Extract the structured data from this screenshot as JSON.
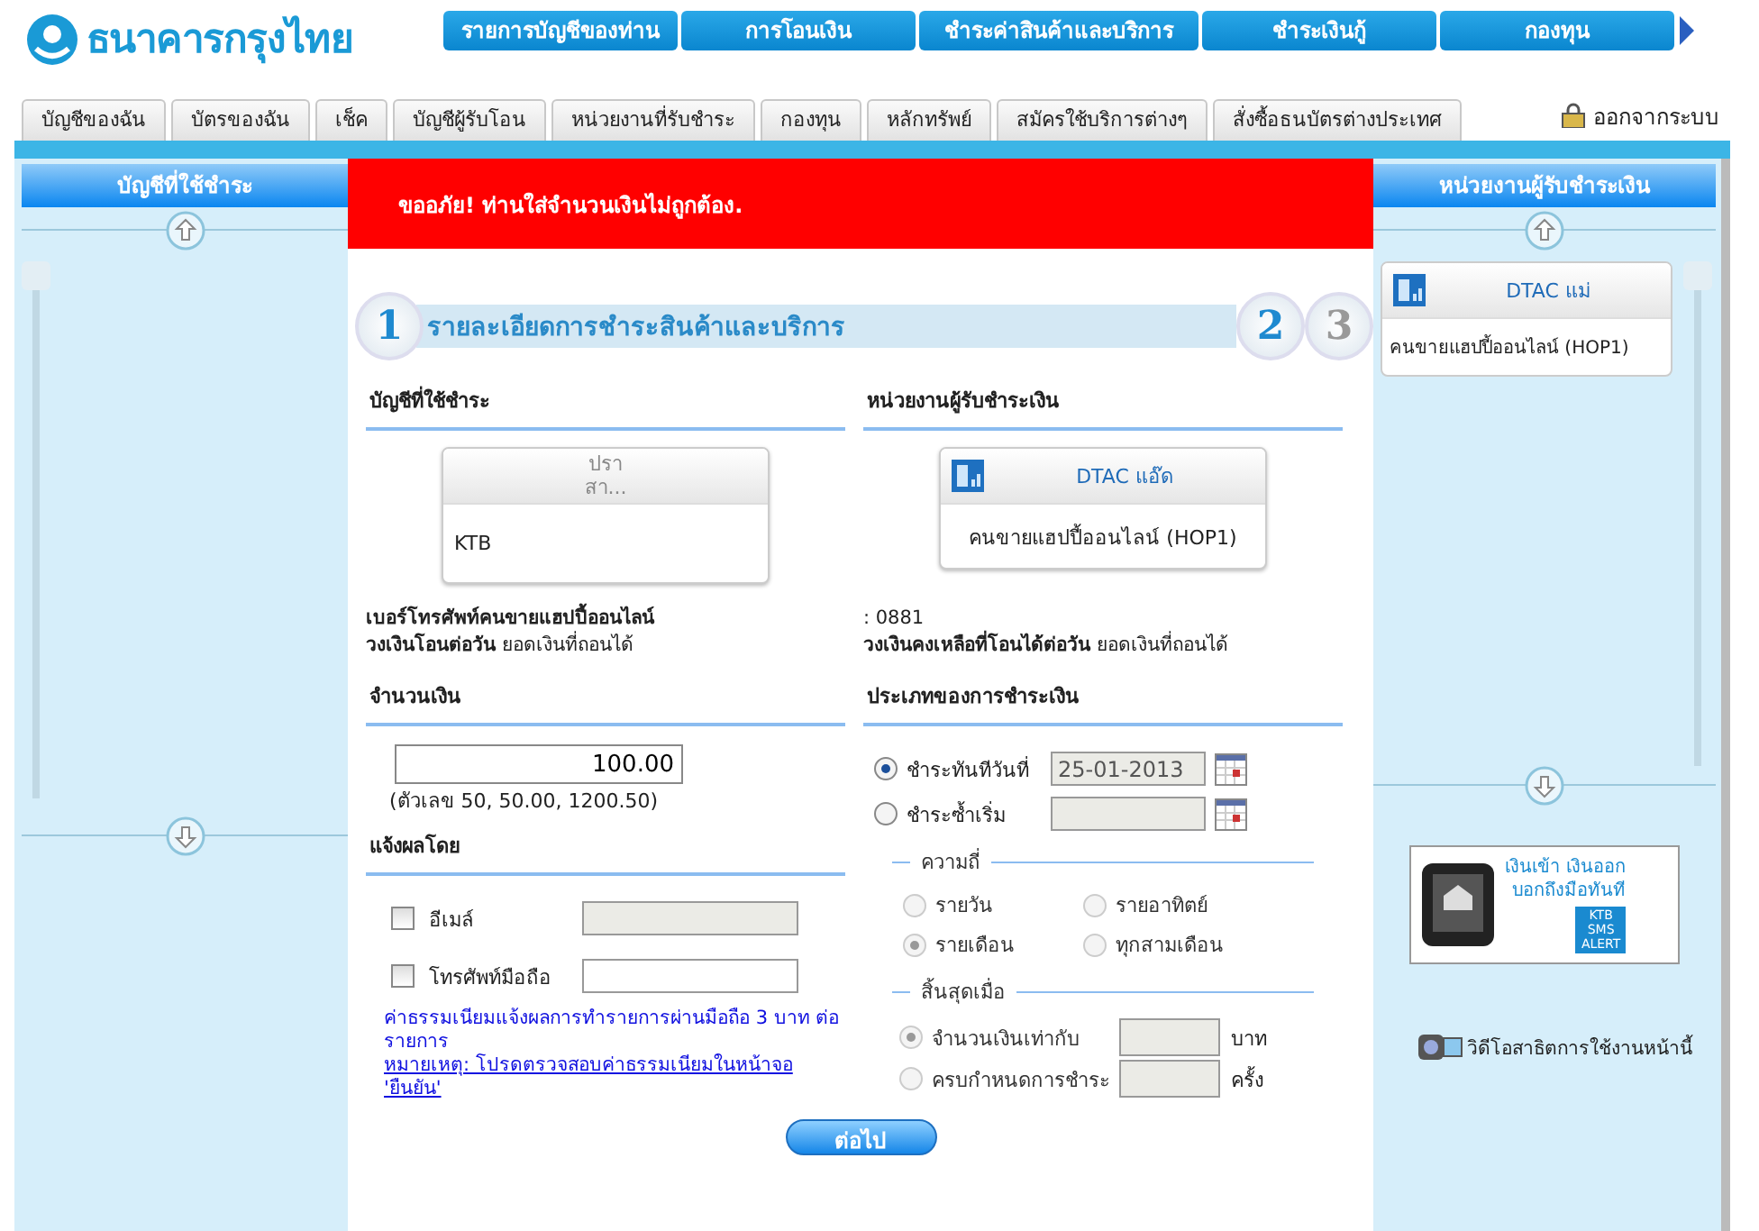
{
  "logo": {
    "text": "ธนาคารกรุงไทย"
  },
  "top_nav": [
    {
      "label": "รายการบัญชีของท่าน"
    },
    {
      "label": "การโอนเงิน"
    },
    {
      "label": "ชำระค่าสินค้าและบริการ"
    },
    {
      "label": "ชำระเงินกู้"
    },
    {
      "label": "กองทุน"
    }
  ],
  "tabs": [
    {
      "label": "บัญชีของฉัน"
    },
    {
      "label": "บัตรของฉัน"
    },
    {
      "label": "เช็ค"
    },
    {
      "label": "บัญชีผู้รับโอน"
    },
    {
      "label": "หน่วยงานที่รับชำระ"
    },
    {
      "label": "กองทุน"
    },
    {
      "label": "หลักทรัพย์"
    },
    {
      "label": "สมัครใช้บริการต่างๆ"
    },
    {
      "label": "สั่งซื้อธนบัตรต่างประเทศ"
    }
  ],
  "logout": {
    "label": "ออกจากระบบ"
  },
  "left_panel": {
    "title": "บัญชีที่ใช้ชำระ"
  },
  "error": {
    "message": "ขออภัย! ท่านใส่จำนวนเงินไม่ถูกต้อง."
  },
  "steps": [
    {
      "number": "1",
      "active": true
    },
    {
      "number": "2",
      "active": true
    },
    {
      "number": "3",
      "active": false
    }
  ],
  "step_title": "รายละเอียดการชำระสินค้าและบริการ",
  "account_section": {
    "heading": "บัญชีที่ใช้ชำระ",
    "card": {
      "name_lines": [
        "ปรา",
        "สา..."
      ],
      "account": "KTB"
    }
  },
  "payee_section": {
    "heading": "หน่วยงานผู้รับชำระเงิน",
    "card": {
      "name": "DTAC แอ๊ด",
      "service": "คนขายแฮปปี้ออนไลน์ (HOP1)"
    }
  },
  "info_rows": [
    {
      "label": "**เบอร์โทรศัพท์คนขายแฮปปี้ออนไลน์**",
      "value": ": 0881"
    },
    {
      "label": "**วงเงินโอนต่อวัน**  ยอดเงินที่ถอนได้",
      "value": "**วงเงินคงเหลือที่โอนได้ต่อวัน**  ยอดเงินที่ถอนได้"
    }
  ],
  "amount": {
    "heading": "จำนวนเงิน",
    "value": "100.00",
    "hint": "(ตัวเลข 50, 50.00, 1200.50)"
  },
  "notify": {
    "heading": "แจ้งผลโดย",
    "options": [
      {
        "label": "อีเมล์",
        "checked": false,
        "disabled": true
      },
      {
        "label": "โทรศัพท์มือถือ",
        "checked": false,
        "disabled": false
      }
    ],
    "fee_note": "ค่าธรรมเนียมแจ้งผลการทำรายการผ่านมือถือ 3 บาท ต่อรายการ",
    "link": "หมายเหตุ: โปรดตรวจสอบค่าธรรมเนียมในหน้าจอ 'ยืนยัน'"
  },
  "payment_type": {
    "heading": "ประเภทของการชำระเงิน",
    "options": [
      {
        "label": "ชำระทันทีวันที่",
        "selected": true,
        "date": "25-01-2013"
      },
      {
        "label": "ชำระซ้ำเริ่ม",
        "selected": false
      }
    ]
  },
  "frequency": {
    "legend": "ความถี่",
    "disabled": true,
    "options": [
      {
        "label": "รายวัน",
        "selected": false
      },
      {
        "label": "รายอาทิตย์",
        "selected": false
      },
      {
        "label": "รายเดือน",
        "selected": true
      },
      {
        "label": "ทุกสามเดือน",
        "selected": false
      }
    ]
  },
  "end": {
    "legend": "สิ้นสุดเมื่อ",
    "disabled": true,
    "options": [
      {
        "label": "จำนวนเงินเท่ากับ",
        "selected": true,
        "unit": "บาท"
      },
      {
        "label": "ครบกำหนดการชำระ",
        "selected": false,
        "unit": "ครั้ง"
      }
    ]
  },
  "next_button": {
    "label": "ต่อไป"
  },
  "right_panel": {
    "title": "หน่วยงานผู้รับชำระเงิน",
    "card": {
      "name": "DTAC แม่",
      "service": "คนขายแฮปปี้ออนไลน์ (HOP1)"
    },
    "banner": {
      "lines": [
        "เงินเข้า เงินออก",
        "บอกถึงมือทันที"
      ],
      "badge": [
        "KTB",
        "SMS",
        "ALERT"
      ]
    },
    "video_link": "วิดีโอสาธิตการใช้งานหน้านี้"
  }
}
